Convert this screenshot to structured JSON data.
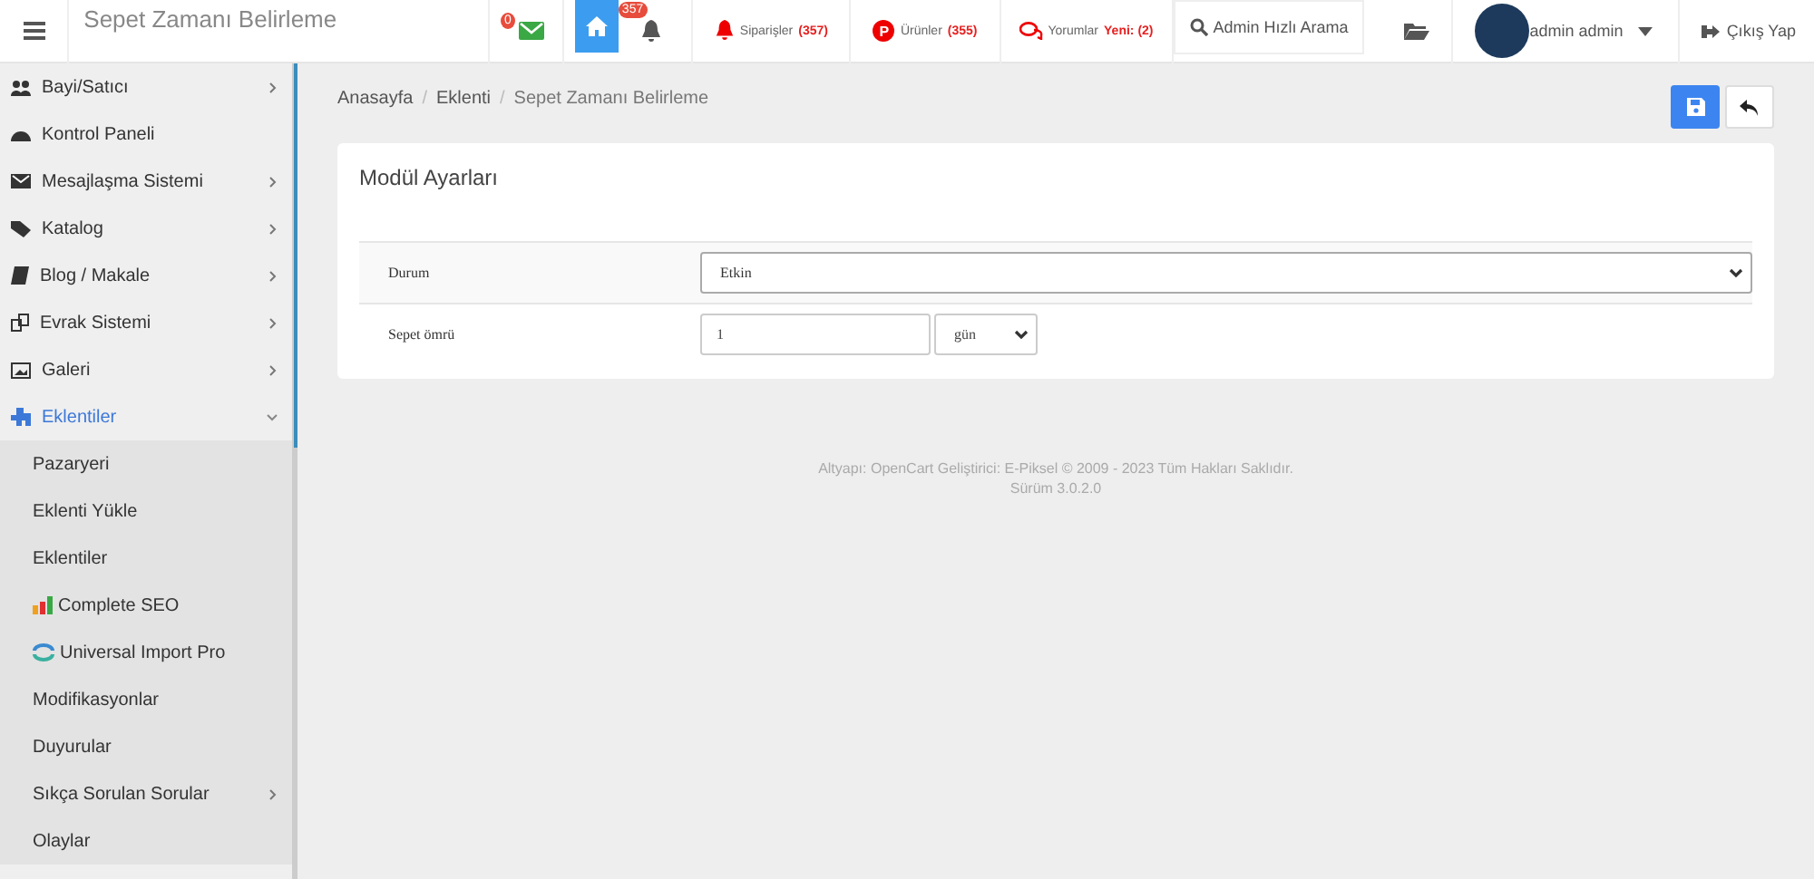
{
  "header": {
    "title": "Sepet Zamanı Belirleme",
    "message_badge": "0",
    "notification_badge": "357",
    "home_selected": true,
    "alerts": [
      {
        "kind": "bell",
        "label": "Siparişler",
        "count": "(357)"
      },
      {
        "kind": "product",
        "label": "Ürünler",
        "count": "(355)",
        "glyph": "P"
      },
      {
        "kind": "comment",
        "label": "Yorumlar",
        "count": "Yeni: (2)"
      }
    ],
    "search": {
      "placeholder": "Admin Hızlı Arama"
    },
    "user": {
      "name": "admin admin"
    },
    "logout": "Çıkış Yap"
  },
  "sidebar": {
    "items": [
      {
        "label": "Bayi/Satıcı",
        "has_children": true,
        "expanded": false
      },
      {
        "label": "Kontrol Paneli",
        "has_children": false,
        "expanded": false
      },
      {
        "label": "Mesajlaşma Sistemi",
        "has_children": true,
        "expanded": false
      },
      {
        "label": "Katalog",
        "has_children": true,
        "expanded": false
      },
      {
        "label": "Blog / Makale",
        "has_children": true,
        "expanded": false
      },
      {
        "label": "Evrak Sistemi",
        "has_children": true,
        "expanded": false
      },
      {
        "label": "Galeri",
        "has_children": true,
        "expanded": false
      },
      {
        "label": "Eklentiler",
        "has_children": true,
        "expanded": true,
        "children": [
          {
            "label": "Pazaryeri",
            "has_children": false
          },
          {
            "label": "Eklenti Yükle",
            "has_children": false
          },
          {
            "label": "Eklentiler",
            "has_children": false
          },
          {
            "label": "Complete SEO",
            "has_children": false
          },
          {
            "label": "Universal Import Pro",
            "has_children": false
          },
          {
            "label": "Modifikasyonlar",
            "has_children": false
          },
          {
            "label": "Duyurular",
            "has_children": false
          },
          {
            "label": "Sıkça Sorulan Sorular",
            "has_children": true
          },
          {
            "label": "Olaylar",
            "has_children": false
          }
        ]
      }
    ]
  },
  "breadcrumb": [
    {
      "kind": "link",
      "text": "Anasayfa"
    },
    {
      "kind": "separator",
      "text": "/"
    },
    {
      "kind": "link",
      "text": "Eklenti"
    },
    {
      "kind": "separator",
      "text": "/"
    },
    {
      "kind": "current",
      "text": "Sepet Zamanı Belirleme"
    }
  ],
  "panel": {
    "title": "Modül Ayarları",
    "fields": [
      {
        "kind": "select",
        "label": "Durum",
        "value": "Etkin"
      },
      {
        "kind": "number_unit",
        "label": "Sepet ömrü",
        "value": "1",
        "unit": "gün"
      }
    ]
  },
  "footer": {
    "credit": "Altyapı: OpenCart Geliştirici: E-Piksel © 2009 - 2023 Tüm Hakları Saklıdır.",
    "version": "Sürüm 3.0.2.0"
  }
}
